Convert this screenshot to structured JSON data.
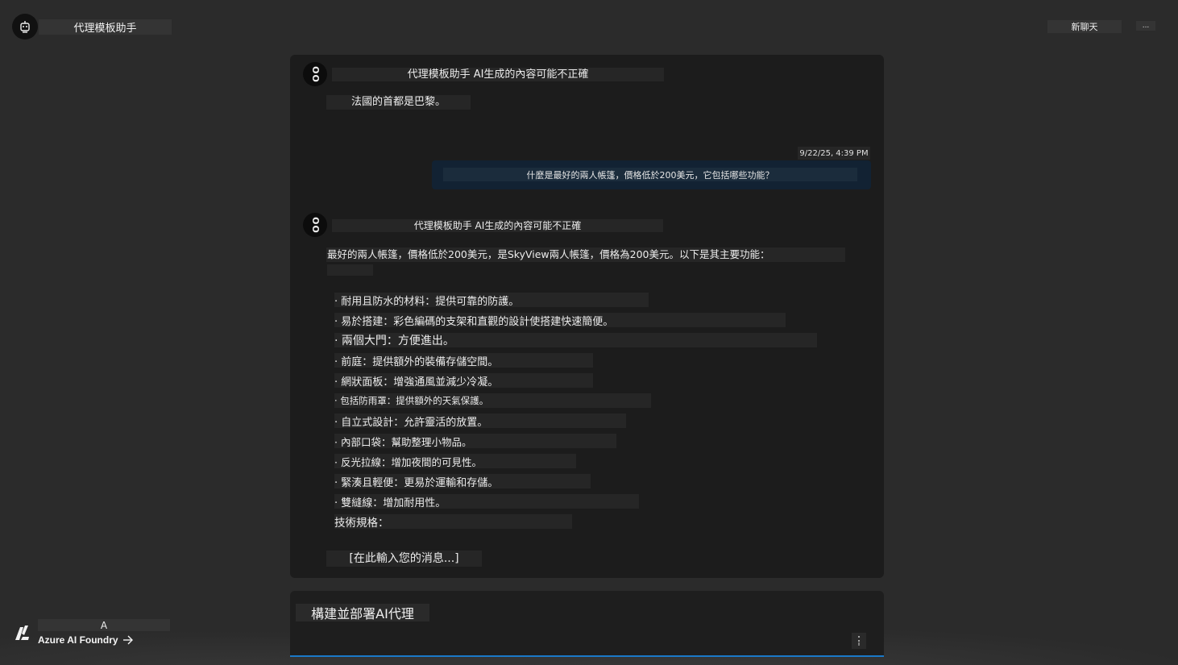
{
  "header": {
    "app_title": "代理模板助手",
    "new_chat_label": "新聊天",
    "more_label": "...",
    "avatar_icon": "robot-icon"
  },
  "chat": {
    "agent_avatar_glyph": "OO",
    "first_message": {
      "header": "代理模板助手 AI生成的內容可能不正確",
      "body": "法國的首都是巴黎。"
    },
    "user_message": {
      "timestamp": "9/22/25, 4:39 PM",
      "text": "什麼是最好的兩人帳篷，價格低於200美元，它包括哪些功能？"
    },
    "second_message": {
      "header": "代理模板助手 AI生成的內容可能不正確",
      "intro": "最好的兩人帳篷，價格低於200美元，是SkyView兩人帳篷，價格為200美元。以下是其主要功能：",
      "bullets": [
        "· 耐用且防水的材料：提供可靠的防護。",
        "· 易於搭建：彩色編碼的支架和直觀的設計使搭建快速簡便。",
        "· 兩個大門：方便進出。",
        "· 前庭：提供額外的裝備存儲空間。",
        "· 網狀面板：增強通風並減少冷凝。",
        "· 包括防雨罩：提供額外的天氣保護。",
        "· 自立式設計：允許靈活的放置。",
        "· 內部口袋：幫助整理小物品。",
        "· 反光拉線：增加夜間的可見性。",
        "· 緊湊且輕便：更易於運輸和存儲。",
        "· 雙縫線：增加耐用性。"
      ],
      "specs_label": "技術規格：",
      "placeholder_line": "[在此輸入您的消息...]"
    }
  },
  "composer": {
    "input_value": "構建並部署AI代理",
    "send_icon": "send-icon"
  },
  "footer": {
    "user_initial": "A",
    "foundry_label": "Azure AI Foundry",
    "arrow_icon": "arrow-right-icon",
    "logo_icon": "azure-foundry-logo-icon"
  },
  "colors": {
    "background": "#2b2b2b",
    "panel": "#1c1c1c",
    "user_bubble": "#122233",
    "accent": "#1a79c8"
  }
}
